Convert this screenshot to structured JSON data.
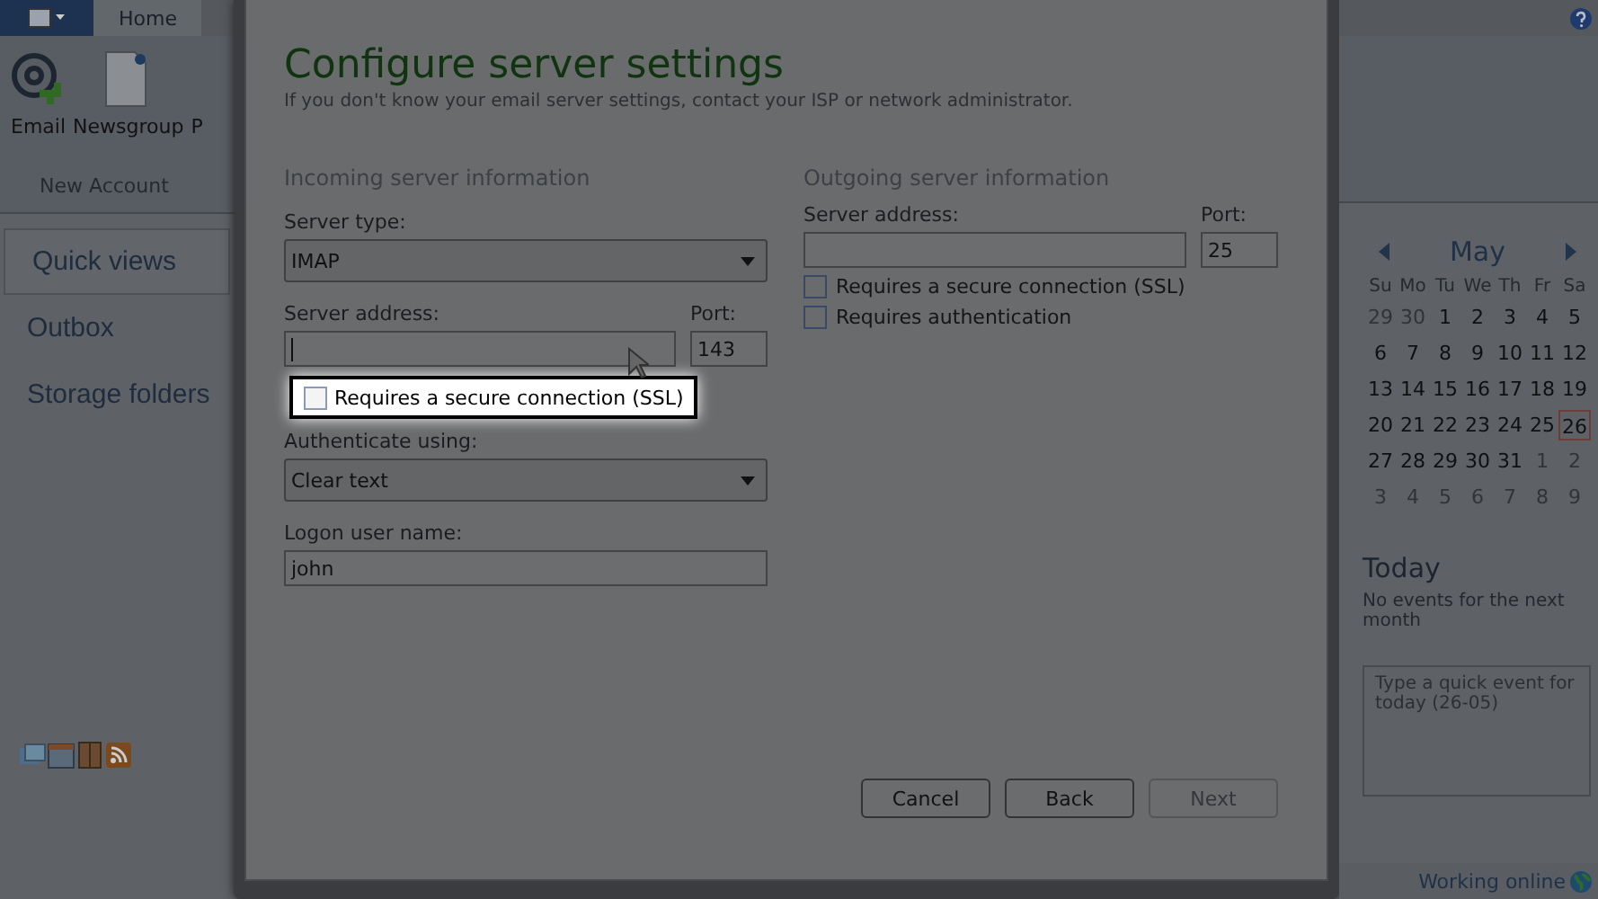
{
  "app": {
    "tabs": [
      {
        "label": "Home",
        "selected": true
      }
    ],
    "ribbon": {
      "buttons": [
        {
          "label": "Email",
          "kind": "email"
        },
        {
          "label": "Newsgroup",
          "kind": "newsgroup"
        },
        {
          "label": "P",
          "kind": "cut"
        }
      ],
      "group_label": "New Account"
    },
    "sidebar": {
      "items": [
        {
          "label": "Quick views",
          "selected": true
        },
        {
          "label": "Outbox",
          "selected": false
        },
        {
          "label": "Storage folders",
          "selected": false
        }
      ]
    },
    "calendar": {
      "month": "May",
      "weekdays": [
        "Su",
        "Mo",
        "Tu",
        "We",
        "Th",
        "Fr",
        "Sa"
      ],
      "days": [
        {
          "label": "29",
          "muted": true,
          "selected": false
        },
        {
          "label": "30",
          "muted": true,
          "selected": false
        },
        {
          "label": "1",
          "muted": false,
          "selected": false
        },
        {
          "label": "2",
          "muted": false,
          "selected": false
        },
        {
          "label": "3",
          "muted": false,
          "selected": false
        },
        {
          "label": "4",
          "muted": false,
          "selected": false
        },
        {
          "label": "5",
          "muted": false,
          "selected": false
        },
        {
          "label": "6",
          "muted": false,
          "selected": false
        },
        {
          "label": "7",
          "muted": false,
          "selected": false
        },
        {
          "label": "8",
          "muted": false,
          "selected": false
        },
        {
          "label": "9",
          "muted": false,
          "selected": false
        },
        {
          "label": "10",
          "muted": false,
          "selected": false
        },
        {
          "label": "11",
          "muted": false,
          "selected": false
        },
        {
          "label": "12",
          "muted": false,
          "selected": false
        },
        {
          "label": "13",
          "muted": false,
          "selected": false
        },
        {
          "label": "14",
          "muted": false,
          "selected": false
        },
        {
          "label": "15",
          "muted": false,
          "selected": false
        },
        {
          "label": "16",
          "muted": false,
          "selected": false
        },
        {
          "label": "17",
          "muted": false,
          "selected": false
        },
        {
          "label": "18",
          "muted": false,
          "selected": false
        },
        {
          "label": "19",
          "muted": false,
          "selected": false
        },
        {
          "label": "20",
          "muted": false,
          "selected": false
        },
        {
          "label": "21",
          "muted": false,
          "selected": false
        },
        {
          "label": "22",
          "muted": false,
          "selected": false
        },
        {
          "label": "23",
          "muted": false,
          "selected": false
        },
        {
          "label": "24",
          "muted": false,
          "selected": false
        },
        {
          "label": "25",
          "muted": false,
          "selected": false
        },
        {
          "label": "26",
          "muted": false,
          "selected": true
        },
        {
          "label": "27",
          "muted": false,
          "selected": false
        },
        {
          "label": "28",
          "muted": false,
          "selected": false
        },
        {
          "label": "29",
          "muted": false,
          "selected": false
        },
        {
          "label": "30",
          "muted": false,
          "selected": false
        },
        {
          "label": "31",
          "muted": false,
          "selected": false
        },
        {
          "label": "1",
          "muted": true,
          "selected": false
        },
        {
          "label": "2",
          "muted": true,
          "selected": false
        },
        {
          "label": "3",
          "muted": true,
          "selected": false
        },
        {
          "label": "4",
          "muted": true,
          "selected": false
        },
        {
          "label": "5",
          "muted": true,
          "selected": false
        },
        {
          "label": "6",
          "muted": true,
          "selected": false
        },
        {
          "label": "7",
          "muted": true,
          "selected": false
        },
        {
          "label": "8",
          "muted": true,
          "selected": false
        },
        {
          "label": "9",
          "muted": true,
          "selected": false
        }
      ]
    },
    "today": {
      "title": "Today",
      "message": "No events for the next month",
      "placeholder": "Type a quick event for today (26-05)"
    },
    "status_bar": {
      "text": "Working online"
    }
  },
  "dialog": {
    "title": "Configure server settings",
    "subtitle": "If you don't know your email server settings, contact your ISP or network administrator.",
    "incoming": {
      "heading": "Incoming server information",
      "server_type_label": "Server type:",
      "server_type": "IMAP",
      "address_label": "Server address:",
      "port_label": "Port:",
      "port": "143",
      "ssl": {
        "label": "Requires a secure connection (SSL)",
        "checked": false,
        "highlighted": true
      },
      "auth_label": "Authenticate using:",
      "auth": "Clear text",
      "user_label": "Logon user name:",
      "user": "john"
    },
    "outgoing": {
      "heading": "Outgoing server information",
      "address_label": "Server address:",
      "port_label": "Port:",
      "port": "25",
      "checkboxes": [
        {
          "label": "Requires a secure connection (SSL)",
          "checked": false
        },
        {
          "label": "Requires authentication",
          "checked": false
        }
      ]
    },
    "buttons": [
      {
        "label": "Cancel",
        "disabled": false
      },
      {
        "label": "Back",
        "disabled": false
      },
      {
        "label": "Next",
        "disabled": true
      }
    ]
  }
}
